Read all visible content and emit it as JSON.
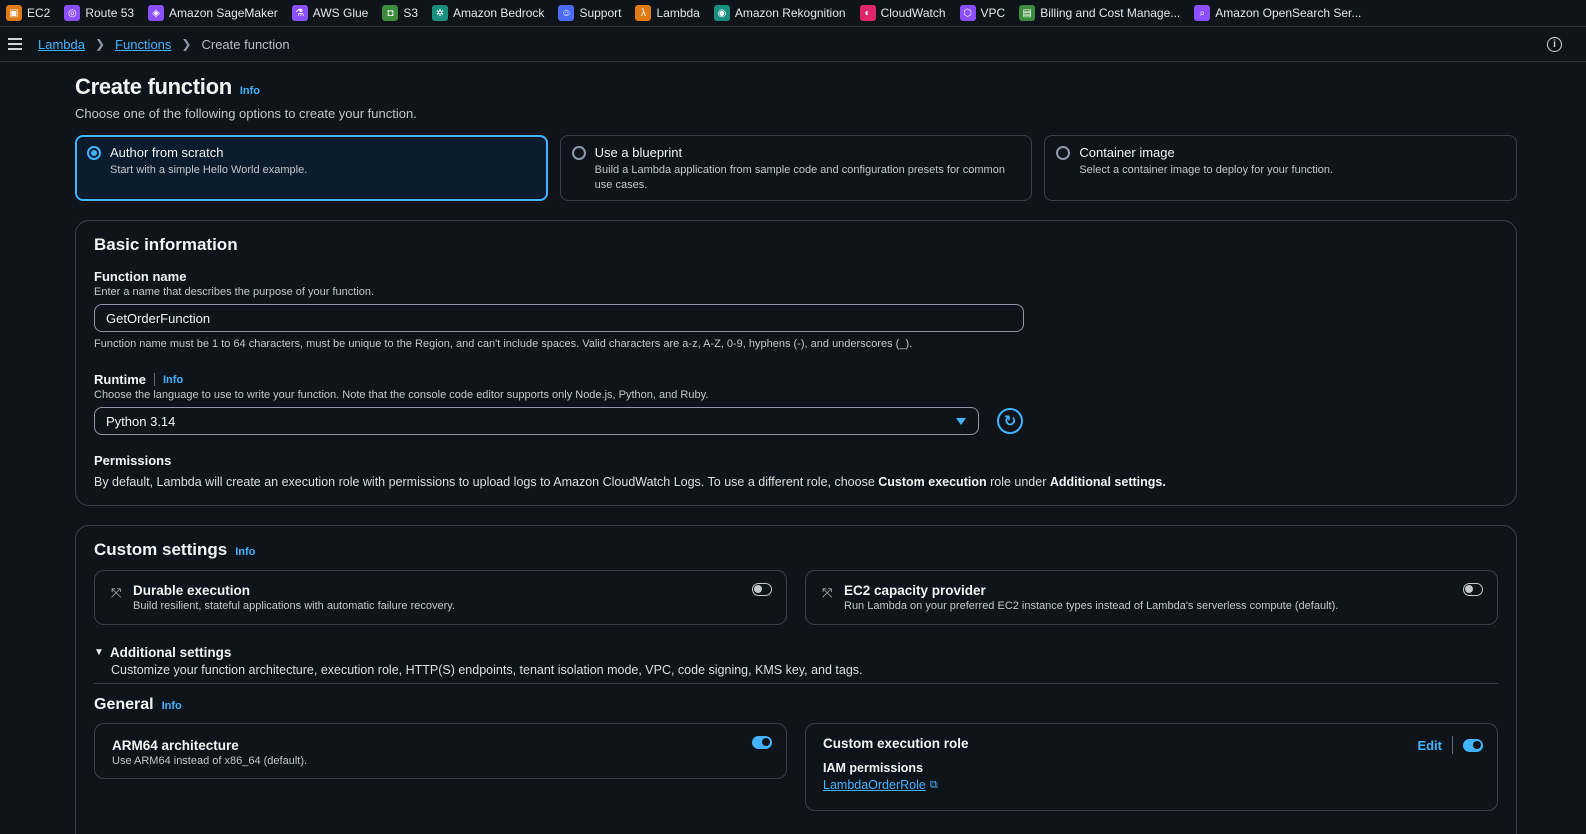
{
  "favorites": [
    {
      "label": "EC2",
      "icon": "ec2-icon",
      "color": "#e07b14"
    },
    {
      "label": "Route 53",
      "icon": "route53-icon",
      "color": "#8c4fff"
    },
    {
      "label": "Amazon SageMaker",
      "icon": "sagemaker-icon",
      "color": "#8c4fff"
    },
    {
      "label": "AWS Glue",
      "icon": "glue-icon",
      "color": "#8c4fff"
    },
    {
      "label": "S3",
      "icon": "s3-icon",
      "color": "#3d8b3d"
    },
    {
      "label": "Amazon Bedrock",
      "icon": "bedrock-icon",
      "color": "#1b8f7f"
    },
    {
      "label": "Support",
      "icon": "support-icon",
      "color": "#4d6cf5"
    },
    {
      "label": "Lambda",
      "icon": "lambda-icon",
      "color": "#e07b14"
    },
    {
      "label": "Amazon Rekognition",
      "icon": "rekognition-icon",
      "color": "#1b8f7f"
    },
    {
      "label": "CloudWatch",
      "icon": "cloudwatch-icon",
      "color": "#e0266b"
    },
    {
      "label": "VPC",
      "icon": "vpc-icon",
      "color": "#8c4fff"
    },
    {
      "label": "Billing and Cost Manage...",
      "icon": "billing-icon",
      "color": "#3d8b3d"
    },
    {
      "label": "Amazon OpenSearch Ser...",
      "icon": "opensearch-icon",
      "color": "#8c4fff"
    }
  ],
  "breadcrumb": {
    "items": [
      "Lambda",
      "Functions"
    ],
    "current": "Create function"
  },
  "page": {
    "title": "Create function",
    "info": "Info",
    "subtitle": "Choose one of the following options to create your function."
  },
  "options": [
    {
      "title": "Author from scratch",
      "desc": "Start with a simple Hello World example.",
      "selected": true
    },
    {
      "title": "Use a blueprint",
      "desc": "Build a Lambda application from sample code and configuration presets for common use cases.",
      "selected": false
    },
    {
      "title": "Container image",
      "desc": "Select a container image to deploy for your function.",
      "selected": false
    }
  ],
  "basic": {
    "title": "Basic information",
    "fn_label": "Function name",
    "fn_desc": "Enter a name that describes the purpose of your function.",
    "fn_value": "GetOrderFunction",
    "fn_constraint": "Function name must be 1 to 64 characters, must be unique to the Region, and can't include spaces. Valid characters are a-z, A-Z, 0-9, hyphens (-), and underscores (_).",
    "runtime_label": "Runtime",
    "runtime_info": "Info",
    "runtime_desc": "Choose the language to use to write your function. Note that the console code editor supports only Node.js, Python, and Ruby.",
    "runtime_value": "Python 3.14",
    "perm_label": "Permissions",
    "perm_text_1": "By default, Lambda will create an execution role with permissions to upload logs to Amazon CloudWatch Logs. To use a different role, choose ",
    "perm_bold_1": "Custom execution",
    "perm_text_2": " role under ",
    "perm_bold_2": "Additional settings."
  },
  "custom": {
    "title": "Custom settings",
    "info": "Info",
    "durable_title": "Durable execution",
    "durable_desc": "Build resilient, stateful applications with automatic failure recovery.",
    "ec2_title": "EC2 capacity provider",
    "ec2_desc": "Run Lambda on your preferred EC2 instance types instead of Lambda's serverless compute (default).",
    "additional_title": "Additional settings",
    "additional_desc": "Customize your function architecture, execution role, HTTP(S) endpoints, tenant isolation mode, VPC, code signing, KMS key, and tags.",
    "general_title": "General",
    "general_info": "Info",
    "arm_title": "ARM64 architecture",
    "arm_desc": "Use ARM64 instead of x86_64 (default).",
    "role_title": "Custom execution role",
    "role_edit": "Edit",
    "iam_label": "IAM permissions",
    "iam_role": "LambdaOrderRole"
  }
}
